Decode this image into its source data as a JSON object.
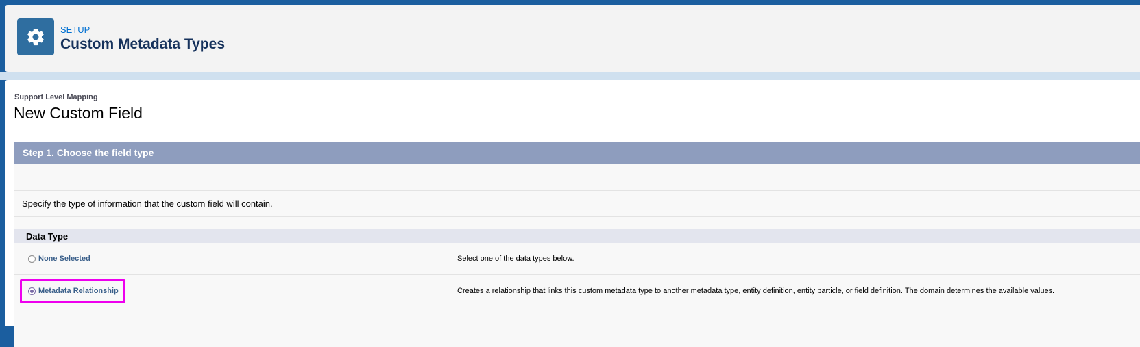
{
  "header": {
    "setup_label": "SETUP",
    "title": "Custom Metadata Types",
    "icon": "gear-icon"
  },
  "page": {
    "breadcrumb": "Support Level Mapping",
    "title": "New Custom Field"
  },
  "step": {
    "title": "Step 1. Choose the field type",
    "instruction": "Specify the type of information that the custom field will contain.",
    "section_title": "Data Type",
    "options": [
      {
        "label": "None Selected",
        "description": "Select one of the data types below.",
        "selected": false
      },
      {
        "label": "Metadata Relationship",
        "description": "Creates a relationship that links this custom metadata type to another metadata type, entity definition, entity particle, or field definition. The domain determines the available values.",
        "selected": true
      }
    ]
  },
  "colors": {
    "brand_blue": "#1b5e9f",
    "step_header": "#8e9dbe",
    "highlight": "#ee00ee"
  }
}
